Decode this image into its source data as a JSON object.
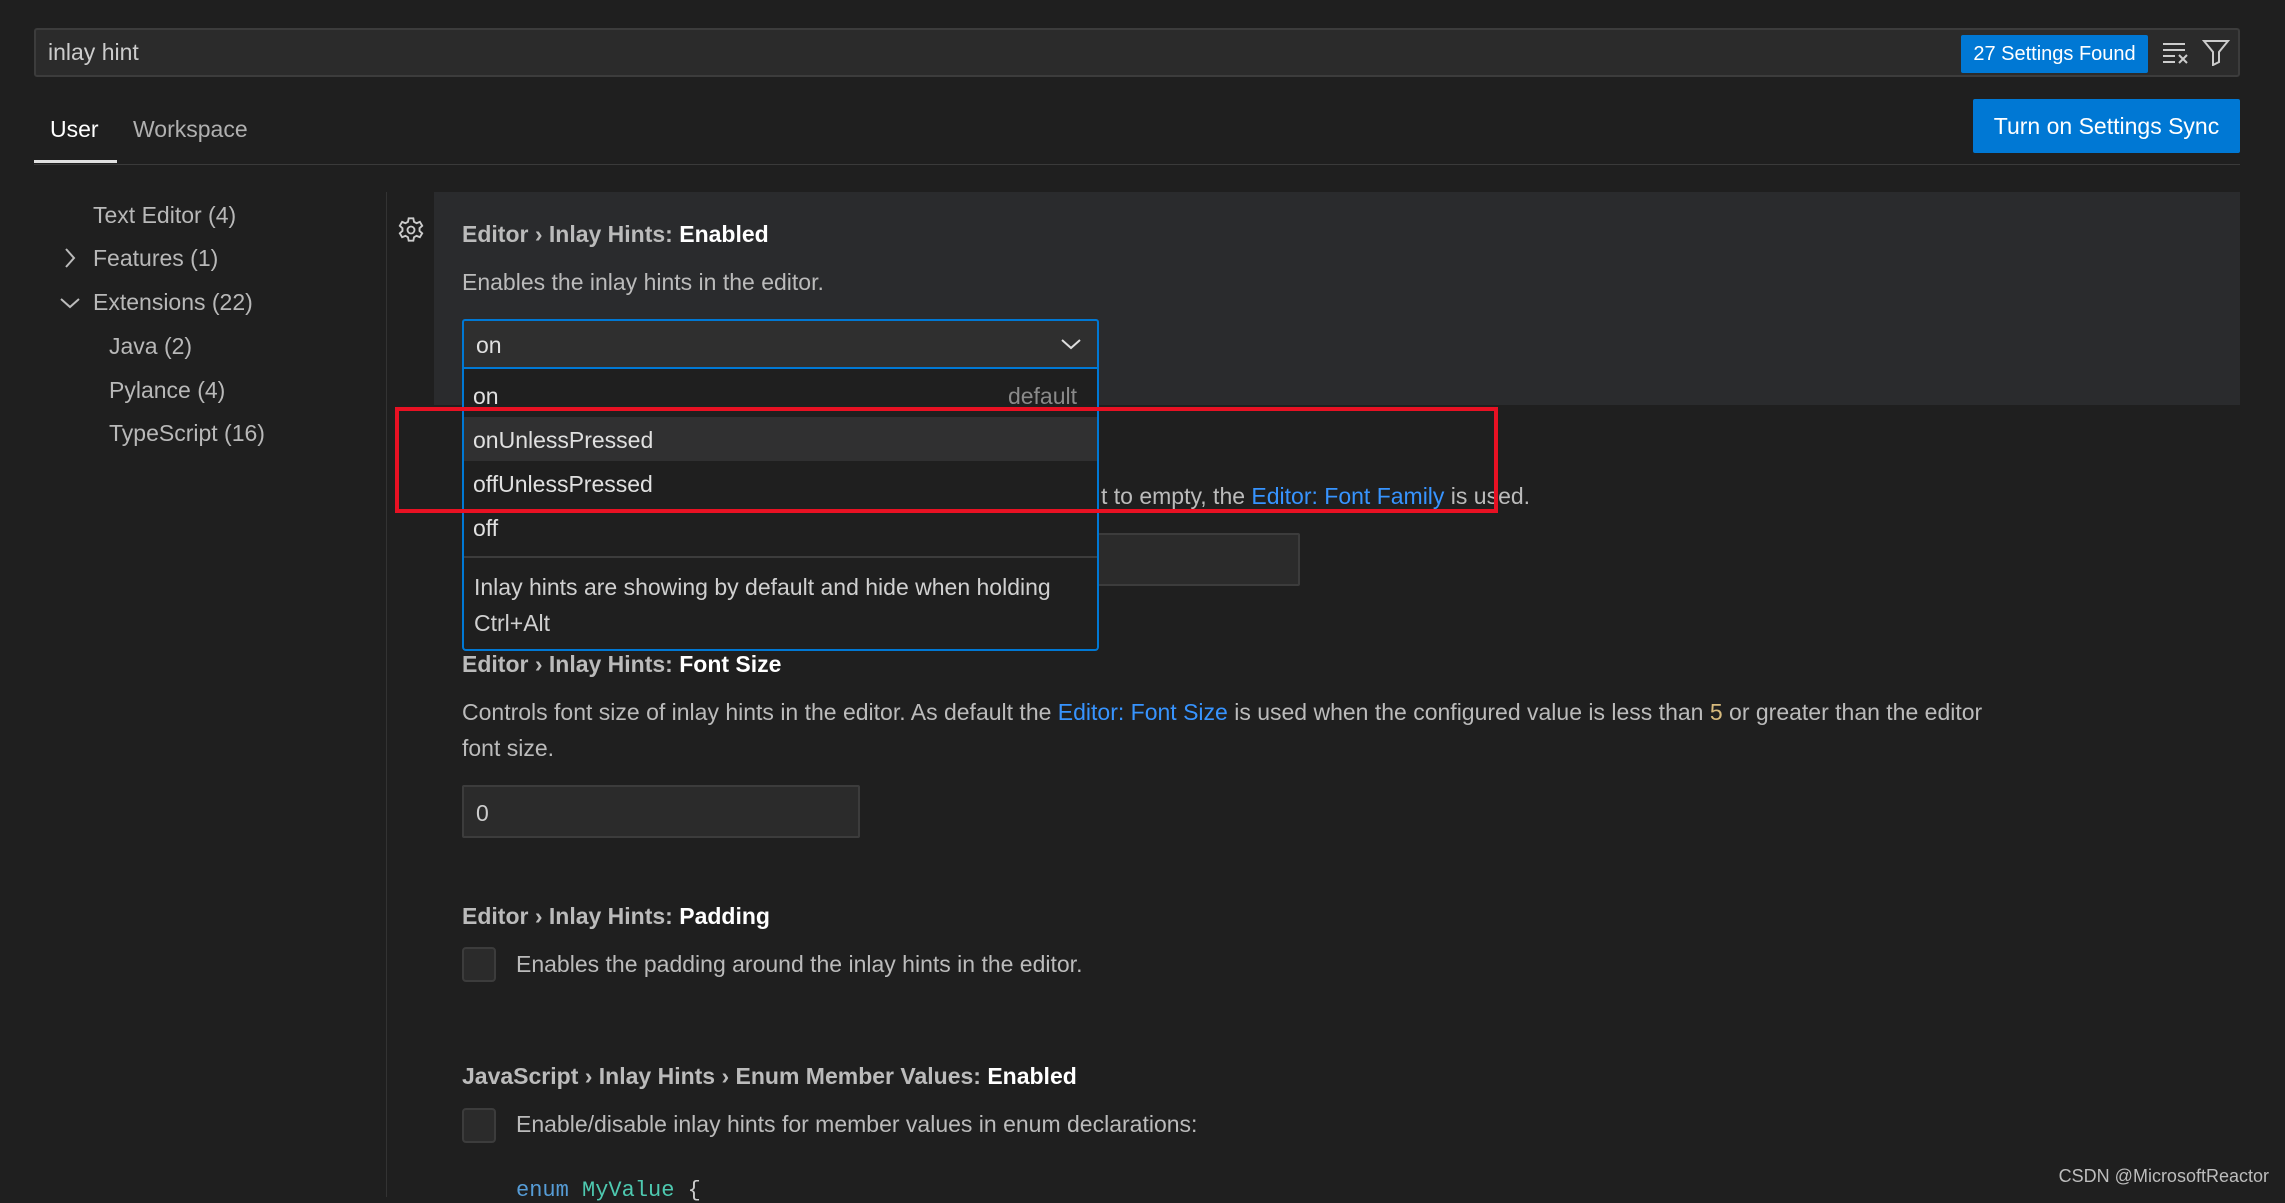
{
  "search": {
    "value": "inlay hint",
    "results_badge": "27 Settings Found",
    "clear_icon": "clear-filter-icon",
    "filter_icon": "filter-icon"
  },
  "tabs": [
    {
      "label": "User",
      "active": true
    },
    {
      "label": "Workspace",
      "active": false
    }
  ],
  "sync_button": "Turn on Settings Sync",
  "tree": [
    {
      "label": "Text Editor (4)"
    },
    {
      "label": "Features (1)",
      "state": "collapsed"
    },
    {
      "label": "Extensions (22)",
      "state": "expanded"
    },
    {
      "label": "Java (2)"
    },
    {
      "label": "Pylance (4)"
    },
    {
      "label": "TypeScript (16)"
    }
  ],
  "settings": {
    "enabled": {
      "prefix": "Editor › Inlay Hints: ",
      "name": "Enabled",
      "description": "Enables the inlay hints in the editor.",
      "value": "on",
      "options": [
        {
          "label": "on",
          "tag": "default"
        },
        {
          "label": "onUnlessPressed",
          "highlighted": true
        },
        {
          "label": "offUnlessPressed"
        },
        {
          "label": "off"
        }
      ],
      "option_description": "Inlay hints are showing by default and hide when holding Ctrl+Alt"
    },
    "font_family": {
      "desc_pre": "t to empty, the ",
      "desc_link": "Editor: Font Family",
      "desc_post": " is used."
    },
    "font_size": {
      "prefix": "Editor › Inlay Hints: ",
      "name": "Font Size",
      "desc_pre": "Controls font size of inlay hints in the editor. As default the ",
      "desc_link": "Editor: Font Size",
      "desc_mid": " is used when the configured value is less than ",
      "desc_num": "5",
      "desc_post": " or greater than the editor",
      "desc_line2": "font size.",
      "value": "0"
    },
    "padding": {
      "prefix": "Editor › Inlay Hints: ",
      "name": "Padding",
      "description": "Enables the padding around the inlay hints in the editor.",
      "checked": false
    },
    "enum_member": {
      "prefix": "JavaScript › Inlay Hints › Enum Member Values: ",
      "name": "Enabled",
      "description": "Enable/disable inlay hints for member values in enum declarations:",
      "checked": false,
      "code_kw": "enum",
      "code_name": "MyValue",
      "code_rest": " {"
    }
  },
  "colors": {
    "accent": "#0078d4",
    "link": "#3794ff",
    "annotation": "#e81123"
  },
  "watermark": "CSDN @MicrosoftReactor"
}
